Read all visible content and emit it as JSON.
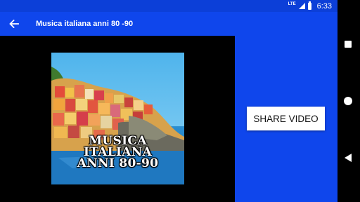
{
  "status_bar": {
    "network": "LTE",
    "time": "6:33"
  },
  "app_bar": {
    "title": "Musica italiana anni 80 -90",
    "back_icon": "arrow-left-icon"
  },
  "thumbnail": {
    "caption_lines": [
      "MUSICA",
      "ITALIANA",
      "ANNI 80-90"
    ]
  },
  "actions": {
    "share_label": "SHARE VIDEO"
  },
  "navigation": {
    "recents_icon": "square-icon",
    "home_icon": "circle-icon",
    "back_icon": "triangle-back-icon"
  },
  "colors": {
    "status_bar": "#0c3fd8",
    "app_bar": "#0f46ec",
    "panel": "#0f46ec",
    "background": "#000000"
  }
}
